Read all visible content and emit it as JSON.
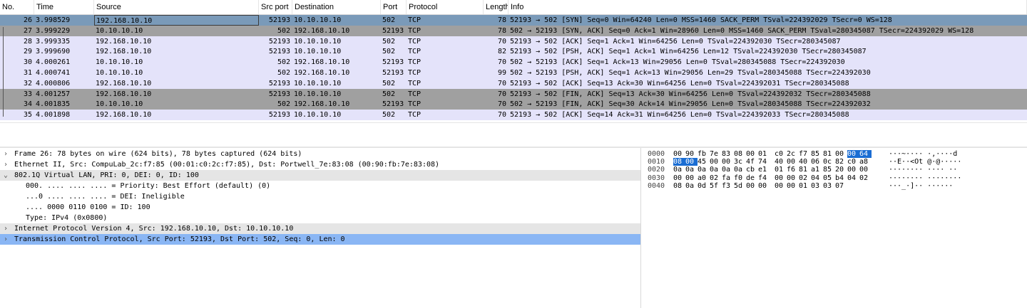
{
  "columns": [
    {
      "key": "no",
      "label": "No."
    },
    {
      "key": "time",
      "label": "Time"
    },
    {
      "key": "source",
      "label": "Source"
    },
    {
      "key": "srcport",
      "label": "Src port"
    },
    {
      "key": "destination",
      "label": "Destination"
    },
    {
      "key": "port",
      "label": "Port"
    },
    {
      "key": "protocol",
      "label": "Protocol"
    },
    {
      "key": "length",
      "label": "Length"
    },
    {
      "key": "info",
      "label": "Info"
    }
  ],
  "packets": [
    {
      "no": "26",
      "time": "3.998529",
      "source": "192.168.10.10",
      "srcport": "52193",
      "destination": "10.10.10.10",
      "port": "502",
      "protocol": "TCP",
      "length": "78",
      "info": "52193 → 502 [SYN] Seq=0 Win=64240 Len=0 MSS=1460 SACK_PERM TSval=224392029 TSecr=0 WS=128",
      "style": "sel"
    },
    {
      "no": "27",
      "time": "3.999229",
      "source": "10.10.10.10",
      "srcport": "502",
      "destination": "192.168.10.10",
      "port": "52193",
      "protocol": "TCP",
      "length": "78",
      "info": "502 → 52193 [SYN, ACK] Seq=0 Ack=1 Win=28960 Len=0 MSS=1460 SACK_PERM TSval=280345087 TSecr=224392029 WS=128",
      "style": "fin"
    },
    {
      "no": "28",
      "time": "3.999335",
      "source": "192.168.10.10",
      "srcport": "52193",
      "destination": "10.10.10.10",
      "port": "502",
      "protocol": "TCP",
      "length": "70",
      "info": "52193 → 502 [ACK] Seq=1 Ack=1 Win=64256 Len=0 TSval=224392030 TSecr=280345087",
      "style": "tcp"
    },
    {
      "no": "29",
      "time": "3.999690",
      "source": "192.168.10.10",
      "srcport": "52193",
      "destination": "10.10.10.10",
      "port": "502",
      "protocol": "TCP",
      "length": "82",
      "info": "52193 → 502 [PSH, ACK] Seq=1 Ack=1 Win=64256 Len=12 TSval=224392030 TSecr=280345087",
      "style": "tcp"
    },
    {
      "no": "30",
      "time": "4.000261",
      "source": "10.10.10.10",
      "srcport": "502",
      "destination": "192.168.10.10",
      "port": "52193",
      "protocol": "TCP",
      "length": "70",
      "info": "502 → 52193 [ACK] Seq=1 Ack=13 Win=29056 Len=0 TSval=280345088 TSecr=224392030",
      "style": "tcp"
    },
    {
      "no": "31",
      "time": "4.000741",
      "source": "10.10.10.10",
      "srcport": "502",
      "destination": "192.168.10.10",
      "port": "52193",
      "protocol": "TCP",
      "length": "99",
      "info": "502 → 52193 [PSH, ACK] Seq=1 Ack=13 Win=29056 Len=29 TSval=280345088 TSecr=224392030",
      "style": "tcp"
    },
    {
      "no": "32",
      "time": "4.000806",
      "source": "192.168.10.10",
      "srcport": "52193",
      "destination": "10.10.10.10",
      "port": "502",
      "protocol": "TCP",
      "length": "70",
      "info": "52193 → 502 [ACK] Seq=13 Ack=30 Win=64256 Len=0 TSval=224392031 TSecr=280345088",
      "style": "tcp"
    },
    {
      "no": "33",
      "time": "4.001257",
      "source": "192.168.10.10",
      "srcport": "52193",
      "destination": "10.10.10.10",
      "port": "502",
      "protocol": "TCP",
      "length": "70",
      "info": "52193 → 502 [FIN, ACK] Seq=13 Ack=30 Win=64256 Len=0 TSval=224392032 TSecr=280345088",
      "style": "fin"
    },
    {
      "no": "34",
      "time": "4.001835",
      "source": "10.10.10.10",
      "srcport": "502",
      "destination": "192.168.10.10",
      "port": "52193",
      "protocol": "TCP",
      "length": "70",
      "info": "502 → 52193 [FIN, ACK] Seq=30 Ack=14 Win=29056 Len=0 TSval=280345088 TSecr=224392032",
      "style": "fin"
    },
    {
      "no": "35",
      "time": "4.001898",
      "source": "192.168.10.10",
      "srcport": "52193",
      "destination": "10.10.10.10",
      "port": "502",
      "protocol": "TCP",
      "length": "70",
      "info": "52193 → 502 [ACK] Seq=14 Ack=31 Win=64256 Len=0 TSval=224392033 TSecr=280345088",
      "style": "tcp"
    }
  ],
  "details": [
    {
      "text": "Frame 26: 78 bytes on wire (624 bits), 78 bytes captured (624 bits)",
      "expand": "›",
      "level": 0,
      "style": ""
    },
    {
      "text": "Ethernet II, Src: CompuLab_2c:f7:85 (00:01:c0:2c:f7:85), Dst: Portwell_7e:83:08 (00:90:fb:7e:83:08)",
      "expand": "›",
      "level": 0,
      "style": ""
    },
    {
      "text": "802.1Q Virtual LAN, PRI: 0, DEI: 0, ID: 100",
      "expand": "⌄",
      "level": 0,
      "style": "hl"
    },
    {
      "text": "000. .... .... .... = Priority: Best Effort (default) (0)",
      "expand": "",
      "level": 1,
      "style": ""
    },
    {
      "text": "...0 .... .... .... = DEI: Ineligible",
      "expand": "",
      "level": 1,
      "style": ""
    },
    {
      "text": ".... 0000 0110 0100 = ID: 100",
      "expand": "",
      "level": 1,
      "style": ""
    },
    {
      "text": "Type: IPv4 (0x0800)",
      "expand": "",
      "level": 1,
      "style": ""
    },
    {
      "text": "Internet Protocol Version 4, Src: 192.168.10.10, Dst: 10.10.10.10",
      "expand": "›",
      "level": 0,
      "style": "hl"
    },
    {
      "text": "Transmission Control Protocol, Src Port: 52193, Dst Port: 502, Seq: 0, Len: 0",
      "expand": "›",
      "level": 0,
      "style": "sel"
    }
  ],
  "bytes": [
    {
      "offset": "0000",
      "hex": [
        "00",
        "90",
        "fb",
        "7e",
        "83",
        "08",
        "00",
        "01",
        "c0",
        "2c",
        "f7",
        "85",
        "81",
        "00",
        "00",
        "64"
      ],
      "sel": [
        14,
        15
      ],
      "ascii": "···~···· ·,····d"
    },
    {
      "offset": "0010",
      "hex": [
        "08",
        "00",
        "45",
        "00",
        "00",
        "3c",
        "4f",
        "74",
        "40",
        "00",
        "40",
        "06",
        "0c",
        "82",
        "c0",
        "a8"
      ],
      "sel": [
        0,
        1
      ],
      "ascii": "··E··<Ot @·@·····"
    },
    {
      "offset": "0020",
      "hex": [
        "0a",
        "0a",
        "0a",
        "0a",
        "0a",
        "0a",
        "cb",
        "e1",
        "01",
        "f6",
        "81",
        "a1",
        "85",
        "20",
        "00",
        "00"
      ],
      "sel": [],
      "ascii": "········ ···· ··"
    },
    {
      "offset": "0030",
      "hex": [
        "00",
        "00",
        "a0",
        "02",
        "fa",
        "f0",
        "de",
        "f4",
        "00",
        "00",
        "02",
        "04",
        "05",
        "b4",
        "04",
        "02"
      ],
      "sel": [],
      "ascii": "········ ········"
    },
    {
      "offset": "0040",
      "hex": [
        "08",
        "0a",
        "0d",
        "5f",
        "f3",
        "5d",
        "00",
        "00",
        "00",
        "00",
        "01",
        "03",
        "03",
        "07"
      ],
      "sel": [],
      "ascii": "···_·]·· ······"
    }
  ],
  "colors": {
    "selected_row": "#7a9ab9",
    "fin_row": "#a0a0a0",
    "tcp_row": "#e4e3fa",
    "detail_selected": "#8ab6f4",
    "byte_selected": "#1a6dd3"
  }
}
